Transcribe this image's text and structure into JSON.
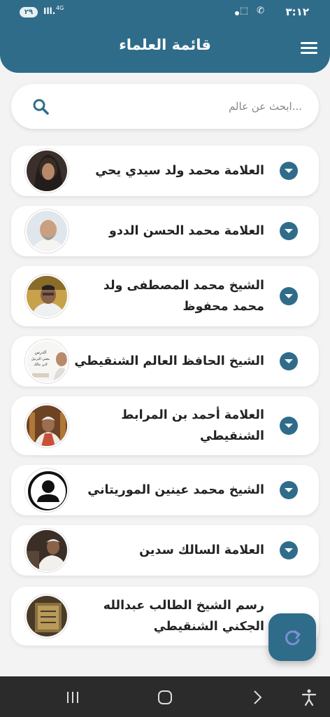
{
  "status_bar": {
    "time": "٣:١٢",
    "battery": "٢٩",
    "network": "4G",
    "signal": "Ill."
  },
  "header": {
    "title": "قائمة العلماء",
    "menu_icon": "hamburger-menu-icon"
  },
  "search": {
    "placeholder": "...ابحث عن عالم",
    "value": ""
  },
  "scholars": [
    {
      "name": "العلامة محمد ولد سيدي يحي"
    },
    {
      "name": "العلامة محمد الحسن الددو"
    },
    {
      "name": "الشيخ محمد المصطفى ولد محمد محفوظ"
    },
    {
      "name": "الشيخ الحافظ العالم الشنقيطي",
      "avatar_text": "الدرس مغني الترتيل لابن مالك"
    },
    {
      "name": "العلامة أحمد بن المرابط الشنقيطي"
    },
    {
      "name": "الشيخ محمد عينين الموريتاني"
    },
    {
      "name": "العلامة السالك سدين"
    },
    {
      "name": "رسم الشيخ الطالب عبدالله الجكني الشنقيطي"
    }
  ],
  "colors": {
    "primary": "#2f6c8a",
    "background": "#f3f3f4",
    "card": "#ffffff",
    "text": "#222222",
    "navbar": "#2b2b2b"
  },
  "fab": {
    "icon": "refresh-icon"
  },
  "navigation": {
    "icons": [
      "recent-apps-icon",
      "home-icon",
      "back-icon",
      "accessibility-icon"
    ]
  }
}
